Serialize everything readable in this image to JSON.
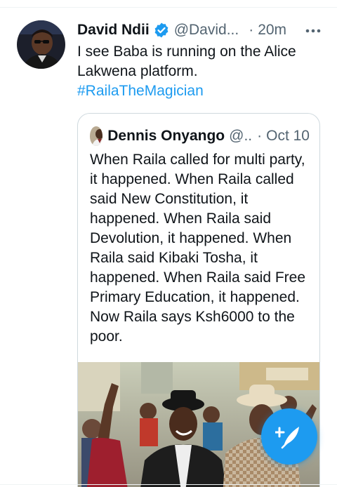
{
  "tweet": {
    "author_name": "David Ndii",
    "handle": "@David...",
    "separator": "·",
    "time": "20m",
    "text": "I see Baba is running on the Alice Lakwena platform.",
    "hashtag": "#RailaTheMagician",
    "verified": true
  },
  "quoted_tweet": {
    "author_name": "Dennis Onyango",
    "handle": "@..",
    "separator": "·",
    "time": "Oct 10",
    "text": "When Raila called for multi party, it happened. When Raila called said  New Constitution, it happened. When Raila said Devolution, it happened. When Raila said Kibaki Tosha, it happened. When Raila said Free Primary Education, it happened. Now Raila says Ksh6000 to the poor."
  },
  "icons": {
    "verified": "verified-badge-icon",
    "more": "more-options-icon",
    "compose": "compose-tweet-icon"
  },
  "colors": {
    "accent": "#1d9bf0",
    "text": "#0f1419",
    "secondary_text": "#536471",
    "border": "#cfd9de"
  }
}
